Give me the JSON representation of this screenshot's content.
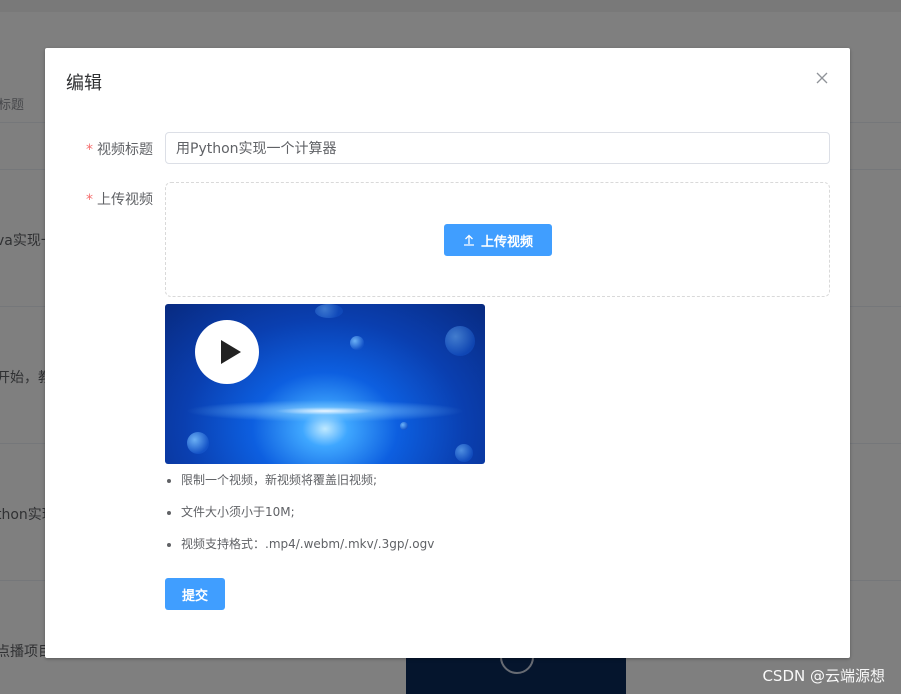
{
  "background": {
    "header_text": "标题",
    "rows": [
      "va实现一",
      "开始，教",
      "thon实现",
      "点播项目"
    ]
  },
  "watermark": "CSDN @云端源想",
  "dialog": {
    "title": "编辑",
    "close_icon": "close-icon",
    "fields": {
      "title_label": "视频标题",
      "title_value": "用Python实现一个计算器",
      "upload_label": "上传视频",
      "required_mark": "*"
    },
    "upload_button_label": "上传视频",
    "upload_icon": "upload-icon",
    "video": {
      "play_icon": "play-icon"
    },
    "tips": [
      "限制一个视频，新视频将覆盖旧视频;",
      "文件大小须小于10M;",
      "视频支持格式：.mp4/.webm/.mkv/.3gp/.ogv"
    ],
    "submit_label": "提交"
  },
  "colors": {
    "primary": "#409eff",
    "required": "#f56c6c",
    "overlay": "rgba(0,0,0,0.5)"
  }
}
